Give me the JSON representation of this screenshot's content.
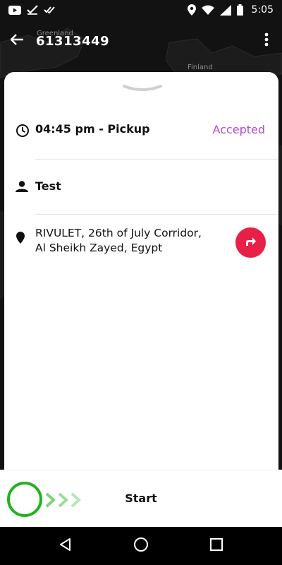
{
  "status_bar": {
    "time": "5:05",
    "left_icons": [
      "youtube-icon",
      "check-icon",
      "double-check-icon"
    ],
    "right_icons": [
      "location-icon",
      "wifi-icon",
      "signal-icon",
      "battery-icon"
    ]
  },
  "map": {
    "labels": {
      "greenland": "Greenland",
      "finland": "Finland"
    }
  },
  "app_bar": {
    "back_icon": "arrow-back-icon",
    "title": "61313449",
    "more_icon": "more-vert-icon"
  },
  "trip": {
    "time_label": "04:45 pm - Pickup",
    "status": "Accepted",
    "status_color": "#b34dc4",
    "customer_name": "Test",
    "address_line1": "RIVULET, 26th of July Corridor,",
    "address_line2": "Al Sheikh Zayed, Egypt",
    "navigate_icon": "directions-icon",
    "navigate_color": "#e81f46"
  },
  "start_bar": {
    "label": "Start",
    "knob_color": "#22b21f"
  },
  "system_nav": {
    "back_icon": "triangle-back-icon",
    "home_icon": "circle-home-icon",
    "recents_icon": "square-recents-icon"
  }
}
